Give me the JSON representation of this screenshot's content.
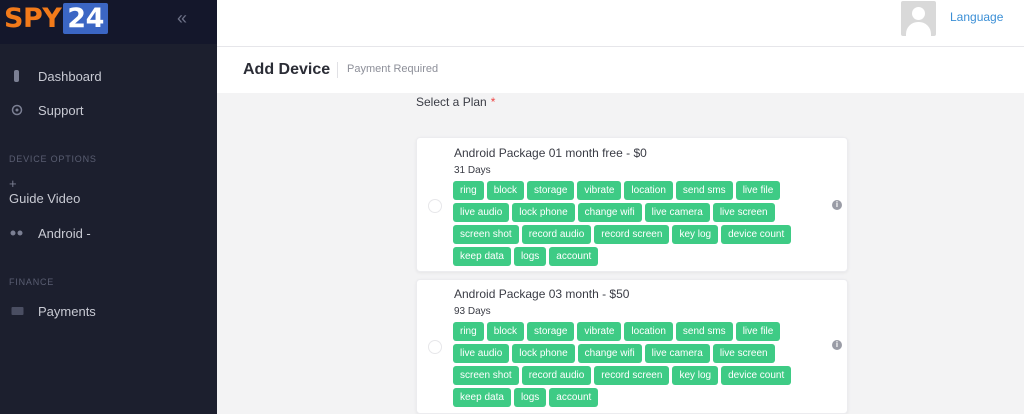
{
  "logo": {
    "part1": "SPY",
    "part2": "24"
  },
  "sidebar": {
    "items": [
      {
        "label": "Dashboard",
        "icon": "dashboard-icon"
      },
      {
        "label": "Support",
        "icon": "support-icon"
      }
    ],
    "section_device": "DEVICE OPTIONS",
    "guide_plus": "+",
    "guide_label": "Guide Video",
    "android_label": "Android -",
    "section_finance": "FINANCE",
    "payments_label": "Payments"
  },
  "topbar": {
    "language": "Language"
  },
  "header": {
    "title": "Add Device",
    "subtitle": "Payment Required"
  },
  "form": {
    "plan_label": "Select a Plan",
    "required_mark": "*"
  },
  "plans": [
    {
      "name": "Android Package 01 month free - $0",
      "days": "31 Days",
      "features": [
        "ring",
        "block",
        "storage",
        "vibrate",
        "location",
        "send sms",
        "live file",
        "live audio",
        "lock phone",
        "change wifi",
        "live camera",
        "live screen",
        "screen shot",
        "record audio",
        "record screen",
        "key log",
        "device count",
        "keep data",
        "logs",
        "account"
      ]
    },
    {
      "name": "Android Package 03 month - $50",
      "days": "93 Days",
      "features": [
        "ring",
        "block",
        "storage",
        "vibrate",
        "location",
        "send sms",
        "live file",
        "live audio",
        "lock phone",
        "change wifi",
        "live camera",
        "live screen",
        "screen shot",
        "record audio",
        "record screen",
        "key log",
        "device count",
        "keep data",
        "logs",
        "account"
      ]
    }
  ],
  "colors": {
    "sidebar_bg": "#1c1f2e",
    "tag_green": "#3ecb85",
    "link_blue": "#3b8fd6",
    "logo_orange": "#f27a1a"
  }
}
